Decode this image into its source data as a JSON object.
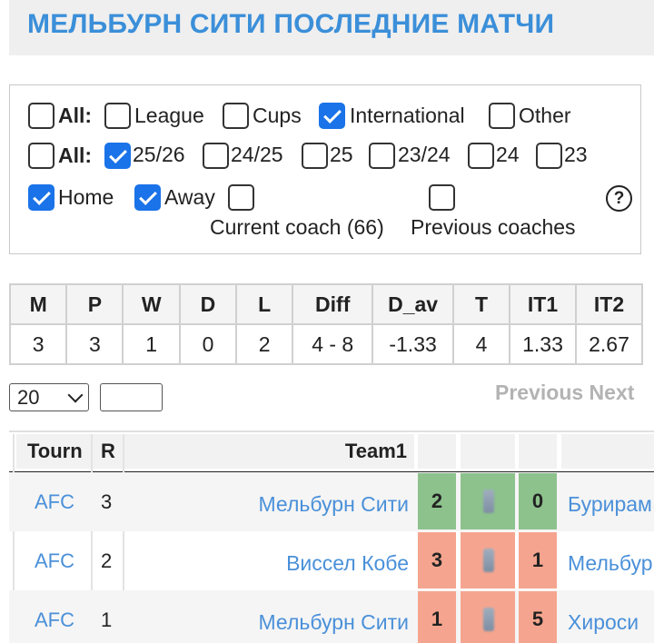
{
  "page_title": "МЕЛЬБУРН СИТИ ПОСЛЕДНИЕ МАТЧИ",
  "filters": {
    "type_all_label": "All:",
    "type_options": [
      {
        "label": "League",
        "checked": false
      },
      {
        "label": "Cups",
        "checked": false
      },
      {
        "label": "International",
        "checked": true
      },
      {
        "label": "Other",
        "checked": false
      }
    ],
    "season_all_label": "All:",
    "season_options": [
      {
        "label": "25/26",
        "checked": true
      },
      {
        "label": "24/25",
        "checked": false
      },
      {
        "label": "25",
        "checked": false
      },
      {
        "label": "23/24",
        "checked": false
      },
      {
        "label": "24",
        "checked": false
      },
      {
        "label": "23",
        "checked": false
      }
    ],
    "home_label": "Home",
    "away_label": "Away",
    "current_coach_label": "Current coach (66)",
    "previous_coaches_label": "Previous coaches",
    "help_label": "?"
  },
  "stats": {
    "headers": [
      "M",
      "P",
      "W",
      "D",
      "L",
      "Diff",
      "D_av",
      "T",
      "IT1",
      "IT2"
    ],
    "values": [
      "3",
      "3",
      "1",
      "0",
      "2",
      "4 - 8",
      "-1.33",
      "4",
      "1.33",
      "2.67"
    ]
  },
  "controls": {
    "page_size": "20",
    "previous_label": "Previous",
    "next_label": "Next"
  },
  "matches": {
    "headers": {
      "tourn": "Tourn",
      "round": "R",
      "team1": "Team1"
    },
    "rows": [
      {
        "tourn": "AFC",
        "round": "3",
        "team1": "Мельбурн Сити",
        "score1": "2",
        "score2": "0",
        "team2": "Бурирам",
        "result_color": "#8dc28d"
      },
      {
        "tourn": "AFC",
        "round": "2",
        "team1": "Виссел Кобе",
        "score1": "3",
        "score2": "1",
        "team2": "Мельбурн",
        "result_color": "#f5a58f"
      },
      {
        "tourn": "AFC",
        "round": "1",
        "team1": "Мельбурн Сити",
        "score1": "1",
        "score2": "5",
        "team2": "Хироси",
        "result_color": "#f5a58f"
      }
    ]
  },
  "colors": {
    "accent": "#3b8fd9",
    "link": "#4a90d9",
    "checkbox_on": "#1a73e8",
    "win": "#8dc28d",
    "loss": "#f5a58f"
  }
}
